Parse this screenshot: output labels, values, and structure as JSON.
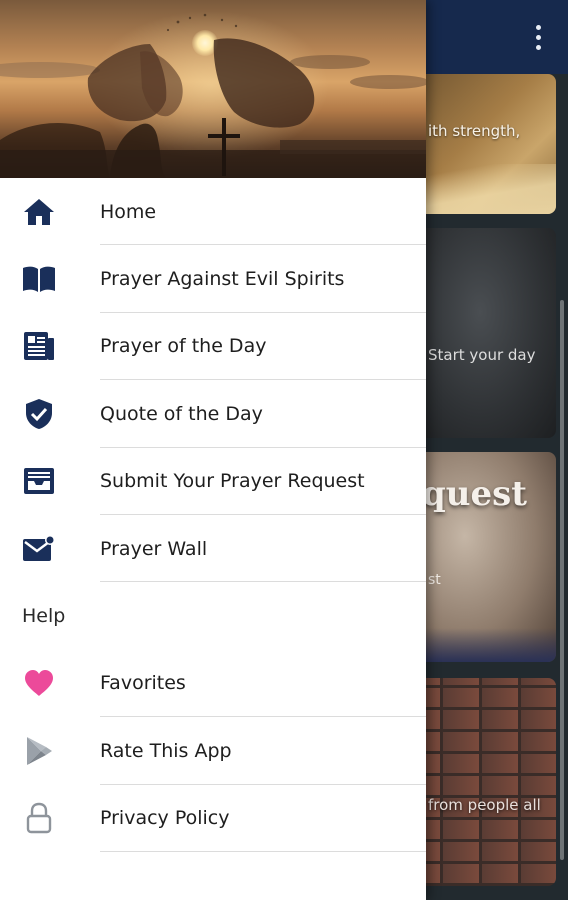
{
  "background_app": {
    "cards": [
      {
        "text": "ith strength,"
      },
      {
        "text": "Start your day"
      },
      {
        "big_text": "quest",
        "text": "st"
      },
      {
        "text": "from people all"
      }
    ]
  },
  "drawer": {
    "menu": [
      {
        "label": "Home",
        "icon": "home-icon"
      },
      {
        "label": "Prayer Against Evil Spirits",
        "icon": "book-open-icon"
      },
      {
        "label": "Prayer of the Day",
        "icon": "newspaper-icon"
      },
      {
        "label": "Quote of the Day",
        "icon": "shield-check-icon"
      },
      {
        "label": "Submit Your Prayer Request",
        "icon": "inbox-icon"
      },
      {
        "label": "Prayer Wall",
        "icon": "mail-notification-icon"
      }
    ],
    "section_title": "Help",
    "help_menu": [
      {
        "label": "Favorites",
        "icon": "heart-icon"
      },
      {
        "label": "Rate This App",
        "icon": "play-store-icon"
      },
      {
        "label": "Privacy Policy",
        "icon": "lock-icon"
      }
    ]
  },
  "colors": {
    "icon_navy": "#1a2f5a",
    "heart_pink": "#ec4a9a",
    "app_bar": "#16294d"
  }
}
